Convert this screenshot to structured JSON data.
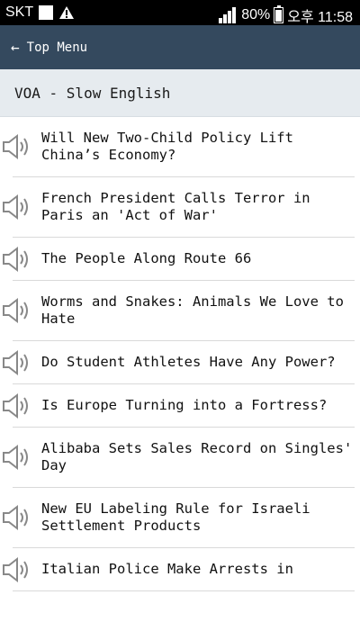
{
  "statusbar": {
    "carrier": "SKT",
    "battery": "80%",
    "time": "오후 11:58"
  },
  "appbar": {
    "back_arrow": "←",
    "title": "Top Menu"
  },
  "section": {
    "title": "VOA - Slow English"
  },
  "items": [
    {
      "title": "Will New Two-Child Policy Lift China’s Economy?"
    },
    {
      "title": "French President Calls Terror in Paris an 'Act of War'"
    },
    {
      "title": "The People Along Route 66"
    },
    {
      "title": "Worms and Snakes: Animals We Love to Hate"
    },
    {
      "title": "Do Student Athletes Have Any Power?"
    },
    {
      "title": "Is Europe Turning into a Fortress?"
    },
    {
      "title": "Alibaba Sets Sales Record on Singles' Day"
    },
    {
      "title": "New EU Labeling Rule for Israeli Settlement Products"
    },
    {
      "title": "Italian Police Make Arrests in"
    }
  ]
}
